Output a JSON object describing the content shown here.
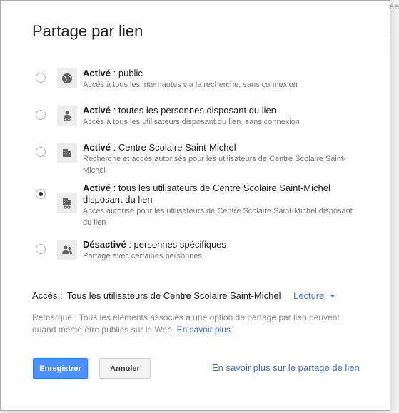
{
  "background": {
    "fragment": "ée"
  },
  "dialog": {
    "title": "Partage par lien",
    "options": [
      {
        "status": "Activé",
        "target": " : public",
        "desc": "Accès à tous les internautes via la recherche, sans connexion",
        "icon": "globe-icon",
        "selected": false
      },
      {
        "status": "Activé",
        "target": " : toutes les personnes disposant du lien",
        "desc": "Accès à tous les utilisateurs disposant du lien, sans connexion",
        "icon": "person-link-icon",
        "selected": false
      },
      {
        "status": "Activé",
        "target": " : Centre Scolaire Saint-Michel",
        "desc": "Recherche et accès autorisés pour les utilisateurs de Centre Scolaire Saint-Michel",
        "icon": "building-icon",
        "selected": false
      },
      {
        "status": "Activé",
        "target": " : tous les utilisateurs de Centre Scolaire Saint-Michel disposant du lien",
        "desc": "Accès autorisé pour les utilisateurs de Centre Scolaire Saint-Michel disposant du lien",
        "icon": "building-link-icon",
        "selected": true
      },
      {
        "status": "Désactivé",
        "target": " : personnes spécifiques",
        "desc": "Partagé avec certaines personnes",
        "icon": "people-icon",
        "selected": false
      }
    ],
    "access": {
      "label": "Accès :",
      "value": "Tous les utilisateurs de Centre Scolaire Saint-Michel",
      "dropdown": "Lecture"
    },
    "note": {
      "text": "Remarque : Tous les éléments associés à une option de partage par lien peuvent quand même être publiés sur le Web.",
      "link": "En savoir plus"
    },
    "buttons": {
      "save": "Enregistrer",
      "cancel": "Annuler"
    },
    "footer_link": "En savoir plus sur le partage de lien"
  },
  "colors": {
    "primary": "#4d90fe",
    "link": "#3b6fd4"
  }
}
